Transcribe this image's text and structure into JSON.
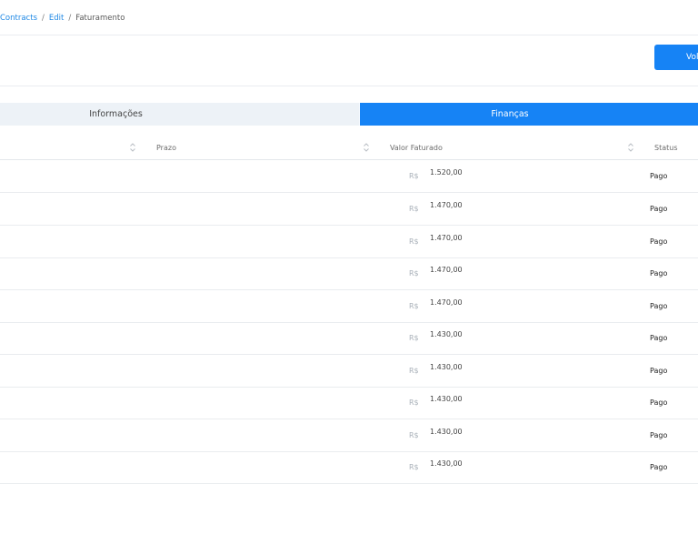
{
  "breadcrumb": {
    "items": [
      "Contracts",
      "Edit"
    ],
    "current": "Faturamento",
    "separator": "/"
  },
  "header": {
    "back_button_label": "Voltar",
    "back_button_visible_text": "Vol"
  },
  "tabs": [
    {
      "label": "Informações",
      "active": false
    },
    {
      "label": "Finanças",
      "active": true
    }
  ],
  "table": {
    "columns": [
      "Prazo",
      "Valor Faturado",
      "Status"
    ],
    "rows": [
      {
        "currency": "R$",
        "value": "1.520,00",
        "status": "Pago"
      },
      {
        "currency": "R$",
        "value": "1.470,00",
        "status": "Pago"
      },
      {
        "currency": "R$",
        "value": "1.470,00",
        "status": "Pago"
      },
      {
        "currency": "R$",
        "value": "1.470,00",
        "status": "Pago"
      },
      {
        "currency": "R$",
        "value": "1.470,00",
        "status": "Pago"
      },
      {
        "currency": "R$",
        "value": "1.430,00",
        "status": "Pago"
      },
      {
        "currency": "R$",
        "value": "1.430,00",
        "status": "Pago"
      },
      {
        "currency": "R$",
        "value": "1.430,00",
        "status": "Pago"
      },
      {
        "currency": "R$",
        "value": "1.430,00",
        "status": "Pago"
      },
      {
        "currency": "R$",
        "value": "1.430,00",
        "status": "Pago"
      }
    ]
  },
  "colors": {
    "accent": "#1683f5",
    "link": "#1e88e5",
    "tab_inactive_bg": "#edf2f7"
  },
  "icons": {
    "sort": "sort-icon"
  }
}
